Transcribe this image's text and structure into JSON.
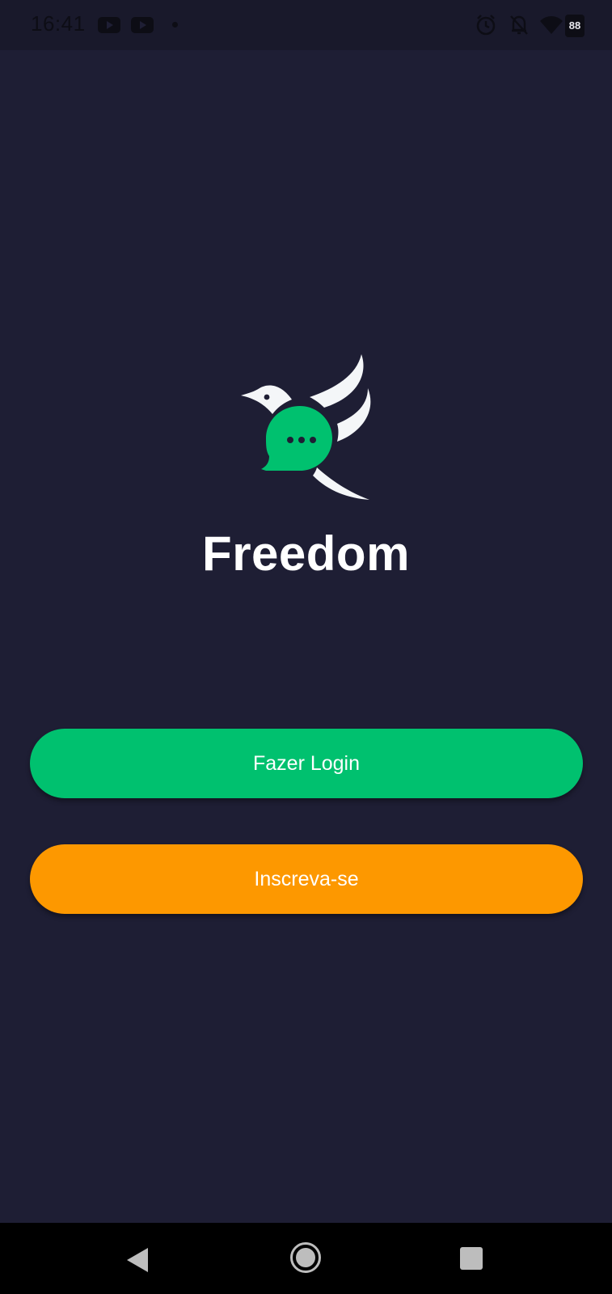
{
  "status_bar": {
    "time": "16:41",
    "battery": "88",
    "icons": [
      "youtube-icon",
      "youtube-icon",
      "notification-dot-icon",
      "alarm-icon",
      "notifications-off-icon",
      "wifi-icon",
      "battery-icon"
    ]
  },
  "brand": {
    "app_name": "Freedom",
    "logo": "bird-chat-bubble-logo",
    "colors": {
      "background": "#1e1e34",
      "primary": "#00c16f",
      "secondary": "#fd9800"
    }
  },
  "actions": {
    "login_label": "Fazer Login",
    "signup_label": "Inscreva-se"
  },
  "nav_bar": {
    "icons": [
      "back-icon",
      "home-icon",
      "recents-icon"
    ]
  }
}
